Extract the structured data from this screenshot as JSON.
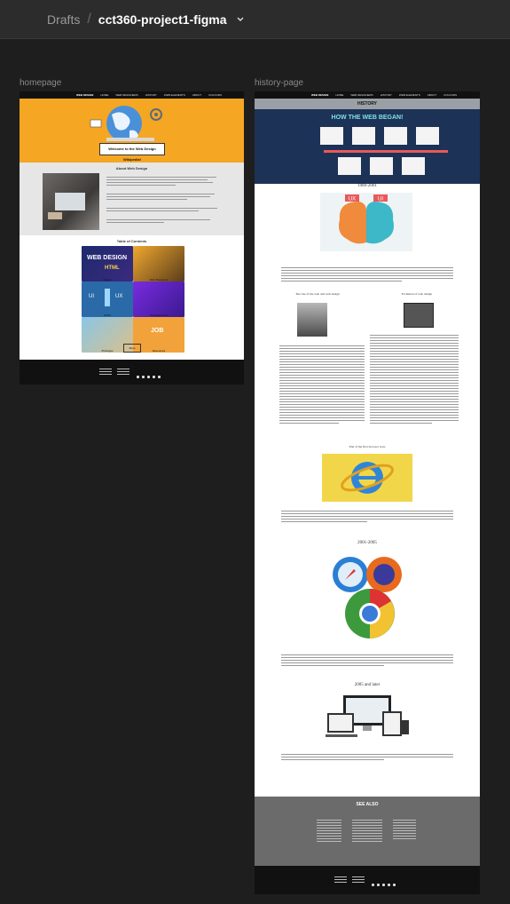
{
  "breadcrumb": {
    "drafts": "Drafts",
    "separator": "/",
    "project": "cct360-project1-figma"
  },
  "frames": {
    "home_label": "homepage",
    "history_label": "history-page"
  },
  "home": {
    "nav_logo": "WEB DESIGN",
    "nav_items": [
      "HOME",
      "WEB DESIGNERS",
      "HISTORY",
      "WEB ELEMENTS",
      "ABOUT",
      "COLOURS"
    ],
    "hero_title": "Welcome to the Web Design Wikipedia!",
    "about_title": "About Web Design",
    "toc_title": "Table of Contents",
    "tiles": [
      "History",
      "Web Designers",
      "UI/UX",
      "Web Elements",
      "Prototype",
      "Resources"
    ],
    "more_button": "More",
    "hero_art_text": "WEB DESIGN"
  },
  "history": {
    "nav_logo": "WEB DESIGN",
    "page_title": "HISTORY",
    "banner_title": "HOW THE WEB BEGAN!",
    "era1": "1989-2001",
    "era2": "2001-2005",
    "era3": "2005 and later",
    "col_left": "The rise of the web and web design",
    "col_right": "Evolution of web design",
    "ie_caption": "End of the first browser wars",
    "see_also": "SEE ALSO",
    "uxui_left": "UX",
    "uxui_right": "UI"
  },
  "colors": {
    "canvas": "#1e1e1e",
    "hero_orange": "#f5a623",
    "history_navy": "#1c3256",
    "footer_gray": "#6b6b6b"
  }
}
